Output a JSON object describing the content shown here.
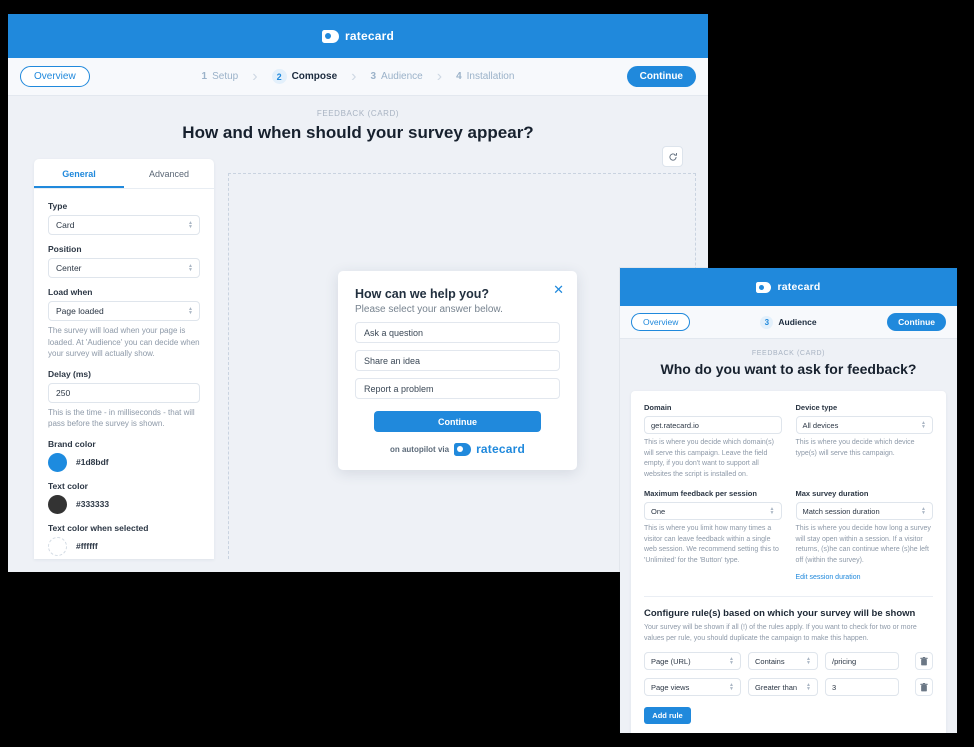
{
  "brand": {
    "blue": "#2089dc",
    "logo_text": "ratecard"
  },
  "window1": {
    "topbar": {
      "logo_text": "ratecard"
    },
    "overview_button": "Overview",
    "continue_button": "Continue",
    "steps": [
      {
        "num": "1",
        "label": "Setup",
        "active": false
      },
      {
        "num": "2",
        "label": "Compose",
        "active": true
      },
      {
        "num": "3",
        "label": "Audience",
        "active": false
      },
      {
        "num": "4",
        "label": "Installation",
        "active": false
      }
    ],
    "eyebrow": "FEEDBACK (CARD)",
    "title": "How and when should your survey appear?",
    "tabs": [
      {
        "label": "General",
        "active": true
      },
      {
        "label": "Advanced",
        "active": false
      }
    ],
    "fields": {
      "type": {
        "label": "Type",
        "value": "Card"
      },
      "position": {
        "label": "Position",
        "value": "Center"
      },
      "load_when": {
        "label": "Load when",
        "value": "Page loaded",
        "help": "The survey will load when your page is loaded. At 'Audience' you can decide when your survey will actually show."
      },
      "delay": {
        "label": "Delay (ms)",
        "value": "250",
        "help": "This is the time - in milliseconds - that will pass before the survey is shown."
      }
    },
    "colors": [
      {
        "label": "Brand color",
        "hex": "#1d8bdf",
        "swatch": "#1d8bdf"
      },
      {
        "label": "Text color",
        "hex": "#333333",
        "swatch": "#333333"
      },
      {
        "label": "Text color when selected",
        "hex": "#ffffff",
        "swatch": "#ffffff"
      }
    ],
    "refresh_icon": "refresh-icon",
    "survey_preview": {
      "question": "How can we help you?",
      "subtitle": "Please select your answer below.",
      "options": [
        "Ask a question",
        "Share an idea",
        "Report a problem"
      ],
      "cta": "Continue",
      "footer_text": "on autopilot via",
      "footer_brand": "ratecard",
      "close_icon": "close-icon"
    }
  },
  "window2": {
    "topbar": {
      "logo_text": "ratecard"
    },
    "overview_button": "Overview",
    "continue_button": "Continue",
    "steps": [
      {
        "num": "3",
        "label": "Audience",
        "active": true
      }
    ],
    "eyebrow": "FEEDBACK (CARD)",
    "title": "Who do you want to ask for feedback?",
    "fields": {
      "domain": {
        "label": "Domain",
        "value": "get.ratecard.io",
        "help": "This is where you decide which domain(s) will serve this campaign. Leave the field empty, if you don't want to support all websites the script is installed on."
      },
      "device_type": {
        "label": "Device type",
        "value": "All devices",
        "help": "This is where you decide which device type(s) will serve this campaign."
      },
      "max_feedback": {
        "label": "Maximum feedback per session",
        "value": "One",
        "help": "This is where you limit how many times a visitor can leave feedback within a single web session. We recommend setting this to 'Unlimited' for the 'Button' type."
      },
      "max_duration": {
        "label": "Max survey duration",
        "value": "Match session duration",
        "help": "This is where you decide how long a survey will stay open within a session. If a visitor returns, (s)he can continue where (s)he left off (within the survey).",
        "link": "Edit session duration"
      }
    },
    "rules_section": {
      "heading": "Configure rule(s) based on which your survey will be shown",
      "subheading": "Your survey will be shown if all (!) of the rules apply. If you want to check for two or more values per rule, you should duplicate the campaign to make this happen.",
      "rows": [
        {
          "field": "Page (URL)",
          "operator": "Contains",
          "value": "/pricing",
          "delete_icon": "trash-icon"
        },
        {
          "field": "Page views",
          "operator": "Greater than",
          "value": "3",
          "delete_icon": "trash-icon"
        }
      ],
      "add_button": "Add rule"
    }
  }
}
